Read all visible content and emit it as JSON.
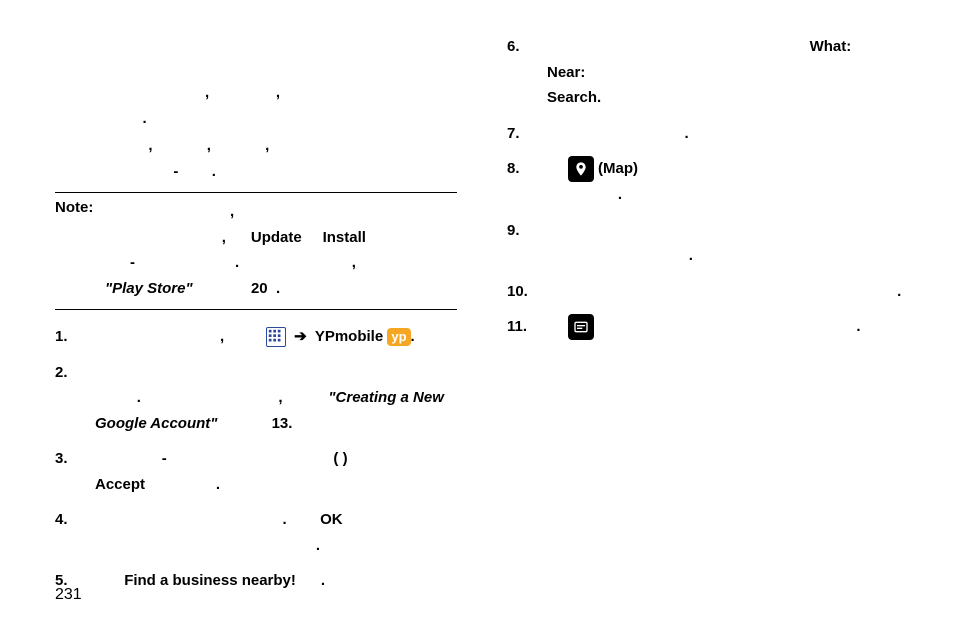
{
  "top_paragraph": {
    "comma1": ",",
    "comma2": ",",
    "period1": ".",
    "comma3": ",",
    "comma4": ",",
    "comma5": ",",
    "dash": "-",
    "period2": "."
  },
  "note": {
    "label": "Note:",
    "comma1": ",",
    "comma2": ",",
    "update": "Update",
    "or": "",
    "install": "Install",
    "dash": "-",
    "period1": ".",
    "comma3": ",",
    "playstore": "\"Play Store\"",
    "page20": "20",
    "period2": "."
  },
  "steps_left": [
    {
      "num": "1.",
      "text_plain": ", ",
      "apps": true,
      "arrow": "➔",
      "yp_label": "YPmobile",
      "yp_badge": "yp",
      "tail": "."
    },
    {
      "num": "2.",
      "text_plain": ". , ",
      "ref": "\"Creating a New Google Account\"",
      "page": "13."
    },
    {
      "num": "3.",
      "dash": "-",
      "paren": "( )",
      "accept": "Accept",
      "period": "."
    },
    {
      "num": "4.",
      "period1": ".",
      "ok": "OK",
      "period2": "."
    },
    {
      "num": "5.",
      "find": "Find a business nearby!",
      "period": "."
    }
  ],
  "steps_right": [
    {
      "num": "6.",
      "what": "What:",
      "near": "Near:",
      "search": "Search",
      "period": "."
    },
    {
      "num": "7.",
      "period": "."
    },
    {
      "num": "8.",
      "map": "(Map)",
      "period": "."
    },
    {
      "num": "9.",
      "period": "."
    },
    {
      "num": "10.",
      "period": "."
    },
    {
      "num": "11.",
      "period": "."
    }
  ],
  "page_number": "231"
}
